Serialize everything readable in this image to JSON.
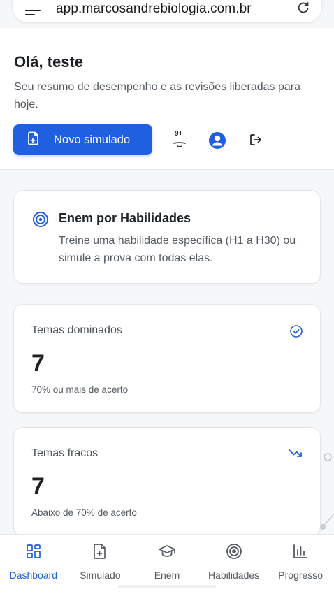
{
  "browser": {
    "url": "app.marcosandrebiologia.com.br",
    "menu_icon": "menu-icon",
    "reload_icon": "reload-icon"
  },
  "header": {
    "greeting": "Olá, teste",
    "subtitle": "Seu resumo de desempenho e as revisões liberadas para hoje.",
    "new_sim_button": "Novo simulado",
    "notification_badge": "9+"
  },
  "enem_card": {
    "title": "Enem por Habilidades",
    "description": "Treine uma habilidade específica (H1 a H30) ou simule a prova com todas elas."
  },
  "stats": [
    {
      "label": "Temas dominados",
      "value": "7",
      "note": "70% ou mais de acerto",
      "icon": "check-circle-icon"
    },
    {
      "label": "Temas fracos",
      "value": "7",
      "note": "Abaixo de 70% de acerto",
      "icon": "trending-down-icon"
    }
  ],
  "bottom_nav": [
    {
      "label": "Dashboard",
      "icon": "dashboard-icon",
      "active": true
    },
    {
      "label": "Simulado",
      "icon": "file-plus-icon",
      "active": false
    },
    {
      "label": "Enem",
      "icon": "graduation-cap-icon",
      "active": false
    },
    {
      "label": "Habilidades",
      "icon": "target-icon",
      "active": false
    },
    {
      "label": "Progresso",
      "icon": "bar-chart-icon",
      "active": false
    }
  ],
  "colors": {
    "accent": "#1f5fe0",
    "background": "#f6f7f8",
    "card": "#ffffff",
    "text": "#1f2328",
    "muted": "#555b63"
  }
}
